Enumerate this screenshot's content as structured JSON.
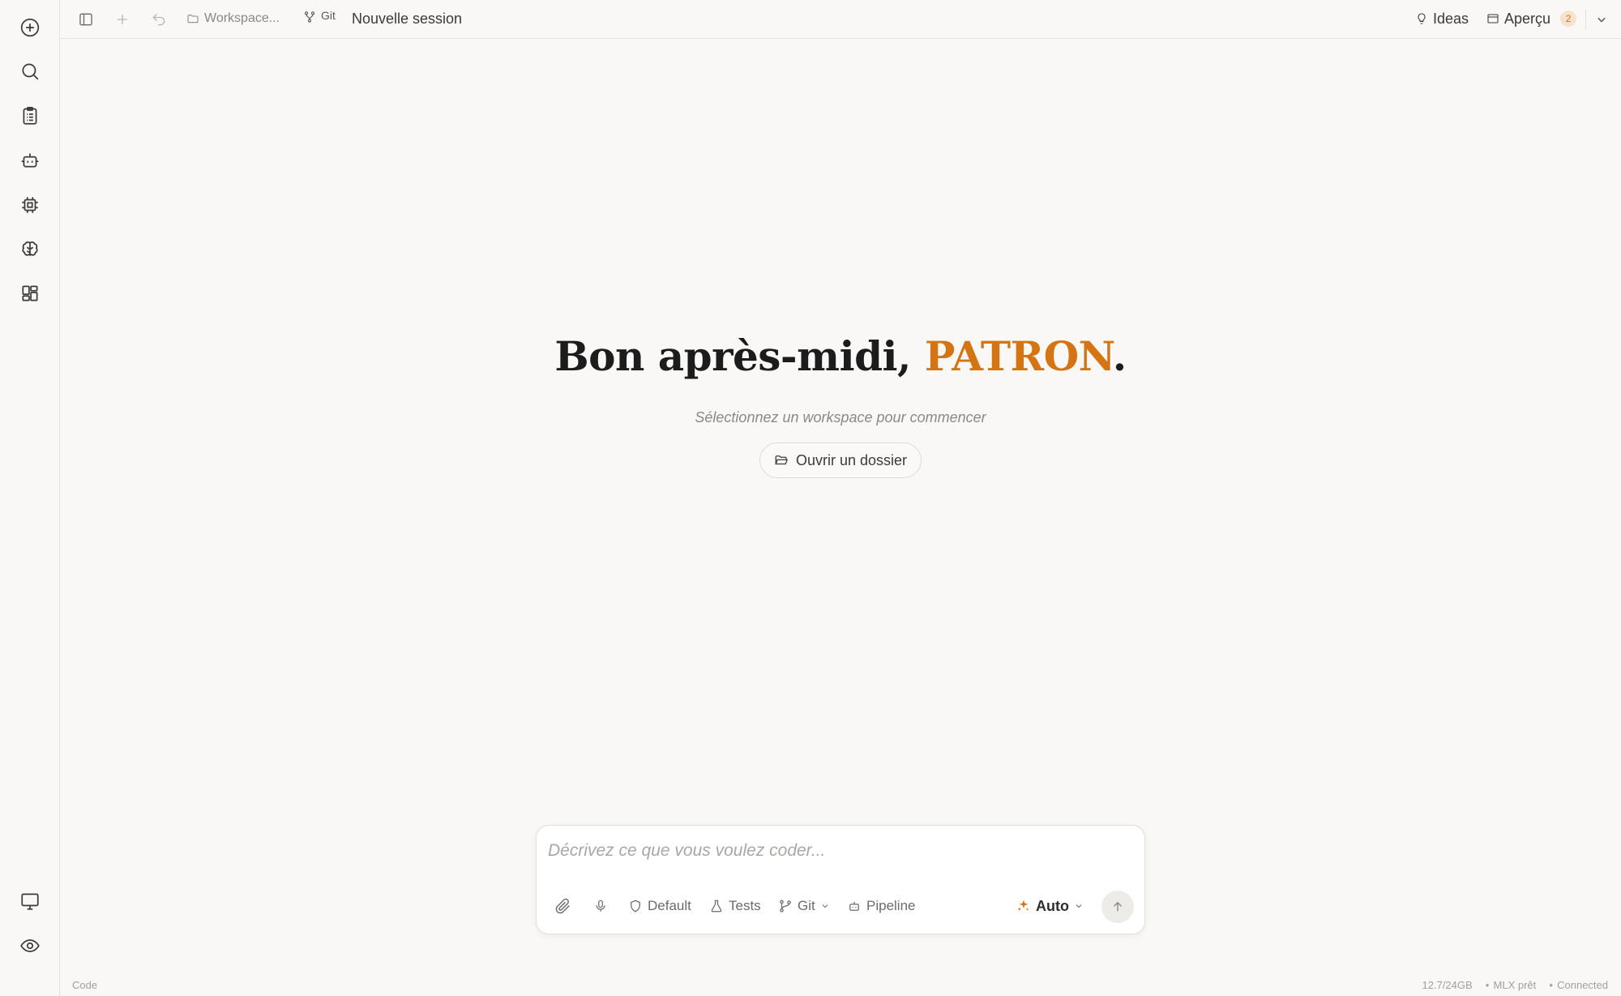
{
  "topbar": {
    "workspace_label": "Workspace...",
    "git_label": "Git",
    "session_title": "Nouvelle session",
    "ideas_label": "Ideas",
    "apercu_label": "Aperçu",
    "apercu_badge": "2"
  },
  "rail": {
    "icons": [
      "new-session-icon",
      "search-icon",
      "clipboard-icon",
      "bot-icon",
      "chip-icon",
      "brain-icon",
      "dashboard-icon",
      "monitor-icon",
      "eye-icon"
    ]
  },
  "hero": {
    "greeting_prefix": "Bon après-midi, ",
    "greeting_name": "PATRON",
    "greeting_suffix": ".",
    "subtitle": "Sélectionnez un workspace pour commencer",
    "open_folder_label": "Ouvrir un dossier"
  },
  "composer": {
    "placeholder": "Décrivez ce que vous voulez coder...",
    "default_label": "Default",
    "tests_label": "Tests",
    "git_label": "Git",
    "pipeline_label": "Pipeline",
    "mode_label": "Auto"
  },
  "status": {
    "mode": "Code",
    "memory": "12.7/24GB",
    "mlx": "MLX prêt",
    "connection": "Connected"
  },
  "colors": {
    "accent": "#d47413",
    "background": "#f9f8f6"
  }
}
